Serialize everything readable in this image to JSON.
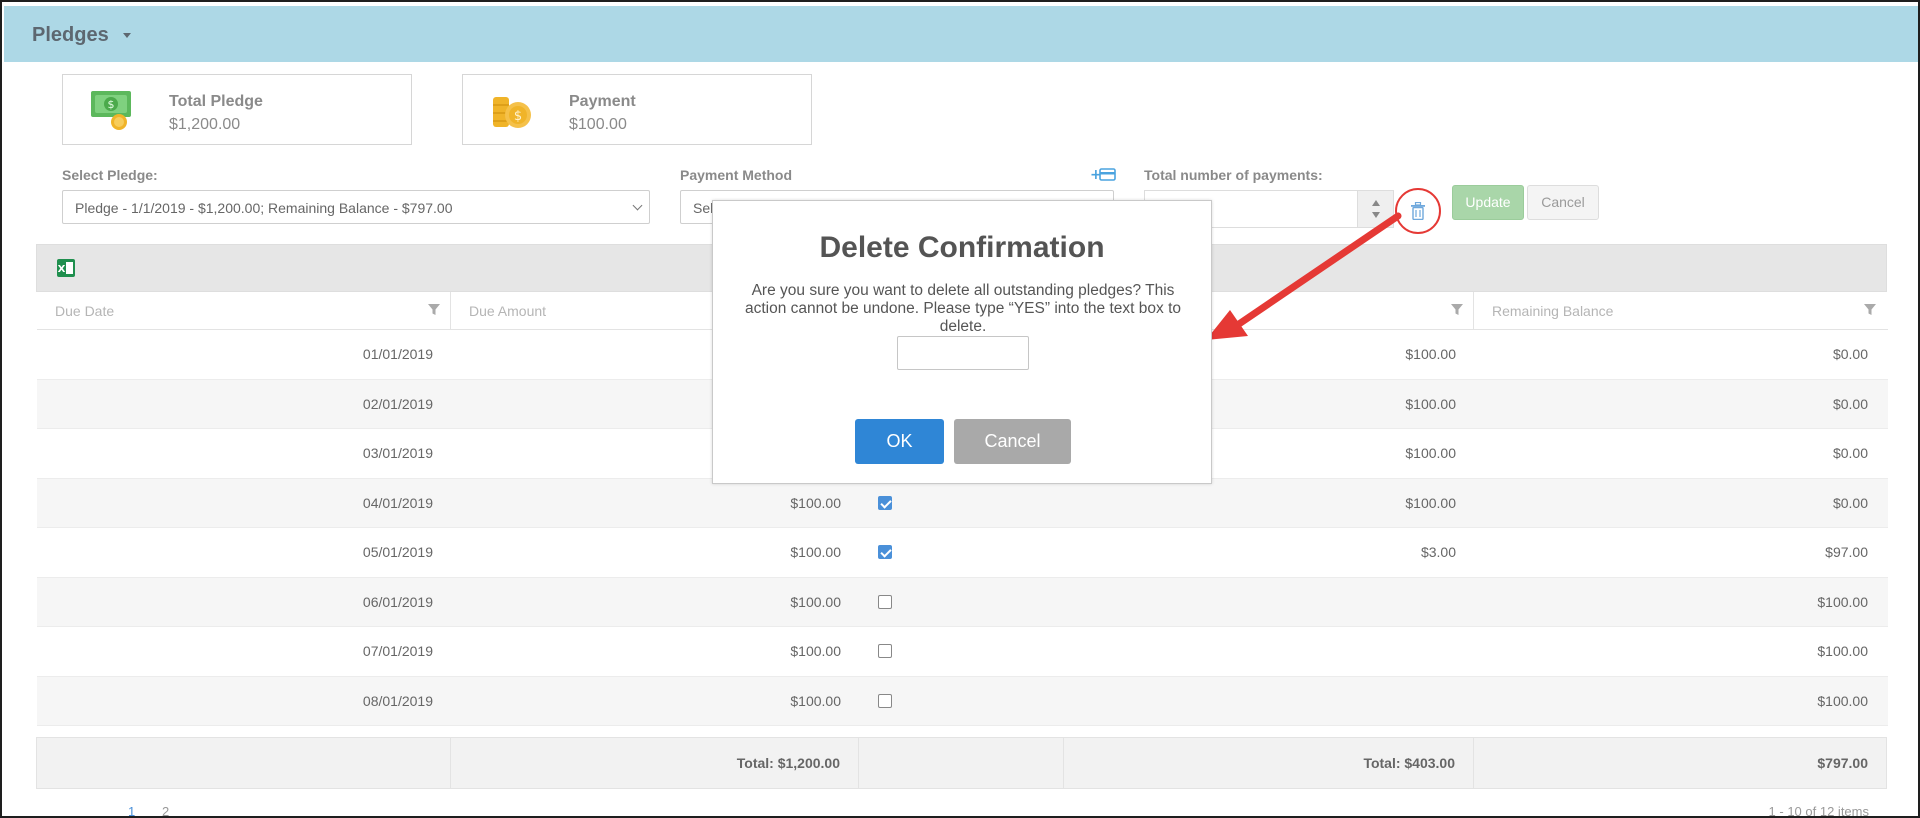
{
  "header": {
    "title": "Pledges"
  },
  "cards": [
    {
      "label": "Total Pledge",
      "value": "$1,200.00",
      "icon": "money-icon"
    },
    {
      "label": "Payment",
      "value": "$100.00",
      "icon": "coins-icon"
    }
  ],
  "form": {
    "select_pledge_label": "Select Pledge:",
    "select_pledge_value": "Pledge - 1/1/2019 - $1,200.00; Remaining Balance - $797.00",
    "payment_method_label": "Payment Method",
    "payment_method_value": "Sel",
    "total_payments_label": "Total number of payments:",
    "update_label": "Update",
    "cancel_label": "Cancel"
  },
  "grid": {
    "columns": [
      "Due Date",
      "Due Amount",
      "",
      "",
      "Remaining Balance"
    ],
    "rows": [
      {
        "date": "01/01/2019",
        "amount": "",
        "checked": null,
        "paid": "$100.00",
        "remaining": "$0.00"
      },
      {
        "date": "02/01/2019",
        "amount": "",
        "checked": null,
        "paid": "$100.00",
        "remaining": "$0.00"
      },
      {
        "date": "03/01/2019",
        "amount": "",
        "checked": null,
        "paid": "$100.00",
        "remaining": "$0.00"
      },
      {
        "date": "04/01/2019",
        "amount": "$100.00",
        "checked": true,
        "paid": "$100.00",
        "remaining": "$0.00"
      },
      {
        "date": "05/01/2019",
        "amount": "$100.00",
        "checked": true,
        "paid": "$3.00",
        "remaining": "$97.00"
      },
      {
        "date": "06/01/2019",
        "amount": "$100.00",
        "checked": false,
        "paid": "",
        "remaining": "$100.00"
      },
      {
        "date": "07/01/2019",
        "amount": "$100.00",
        "checked": false,
        "paid": "",
        "remaining": "$100.00"
      },
      {
        "date": "08/01/2019",
        "amount": "$100.00",
        "checked": false,
        "paid": "",
        "remaining": "$100.00"
      }
    ],
    "footer": {
      "total_amount": "Total: $1,200.00",
      "total_paid": "Total: $403.00",
      "total_remaining": "$797.00"
    },
    "pager": {
      "page1": "1",
      "page2": "2",
      "info": "1 - 10 of 12 items"
    }
  },
  "dialog": {
    "title": "Delete Confirmation",
    "message": "Are you sure you want to delete all outstanding pledges? This action cannot be undone. Please type “YES” into the text box to delete.",
    "input_value": "",
    "ok_label": "OK",
    "cancel_label": "Cancel"
  },
  "colors": {
    "header_bg": "#add8e6",
    "ok_button": "#2f86d6",
    "annotation": "#e53935"
  }
}
